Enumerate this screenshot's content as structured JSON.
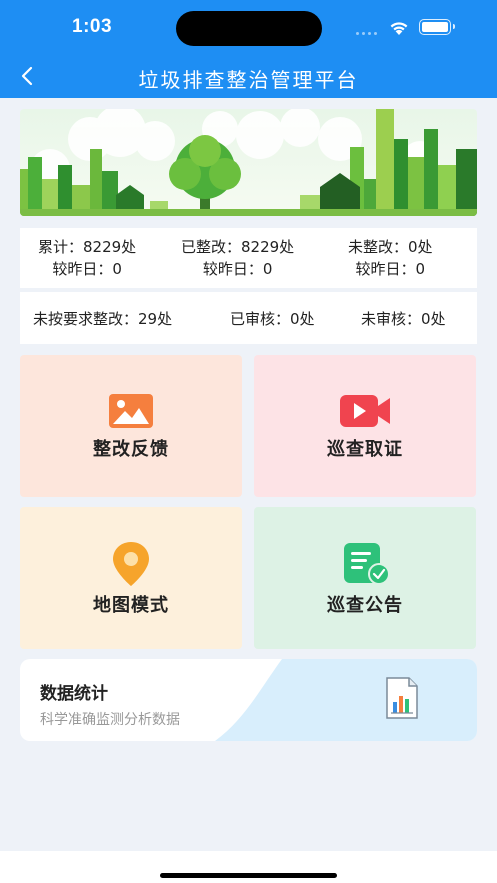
{
  "status_bar": {
    "time": "1:03"
  },
  "header": {
    "title": "垃圾排查整治管理平台"
  },
  "stats": {
    "total": {
      "label": "累计：8229处",
      "change": "较昨日：0"
    },
    "fixed": {
      "label": "已整改：8229处",
      "change": "较昨日：0"
    },
    "unfixed": {
      "label": "未整改：0处",
      "change": "较昨日：0"
    },
    "noncompliant": "未按要求整改：29处",
    "reviewed": "已审核：0处",
    "unreviewed": "未审核：0处"
  },
  "cards": [
    {
      "label": "整改反馈",
      "icon": "image-icon",
      "bg": "#fde6dc"
    },
    {
      "label": "巡查取证",
      "icon": "video-camera-icon",
      "bg": "#fde3e6"
    },
    {
      "label": "地图模式",
      "icon": "map-pin-icon",
      "bg": "#fdf0dc"
    },
    {
      "label": "巡查公告",
      "icon": "announcement-icon",
      "bg": "#ddf2e5"
    }
  ],
  "data_stats": {
    "title": "数据统计",
    "subtitle": "科学准确监测分析数据",
    "icon": "report-chart-icon"
  },
  "colors": {
    "header": "#1e8ef3",
    "background": "#eef2f8"
  }
}
